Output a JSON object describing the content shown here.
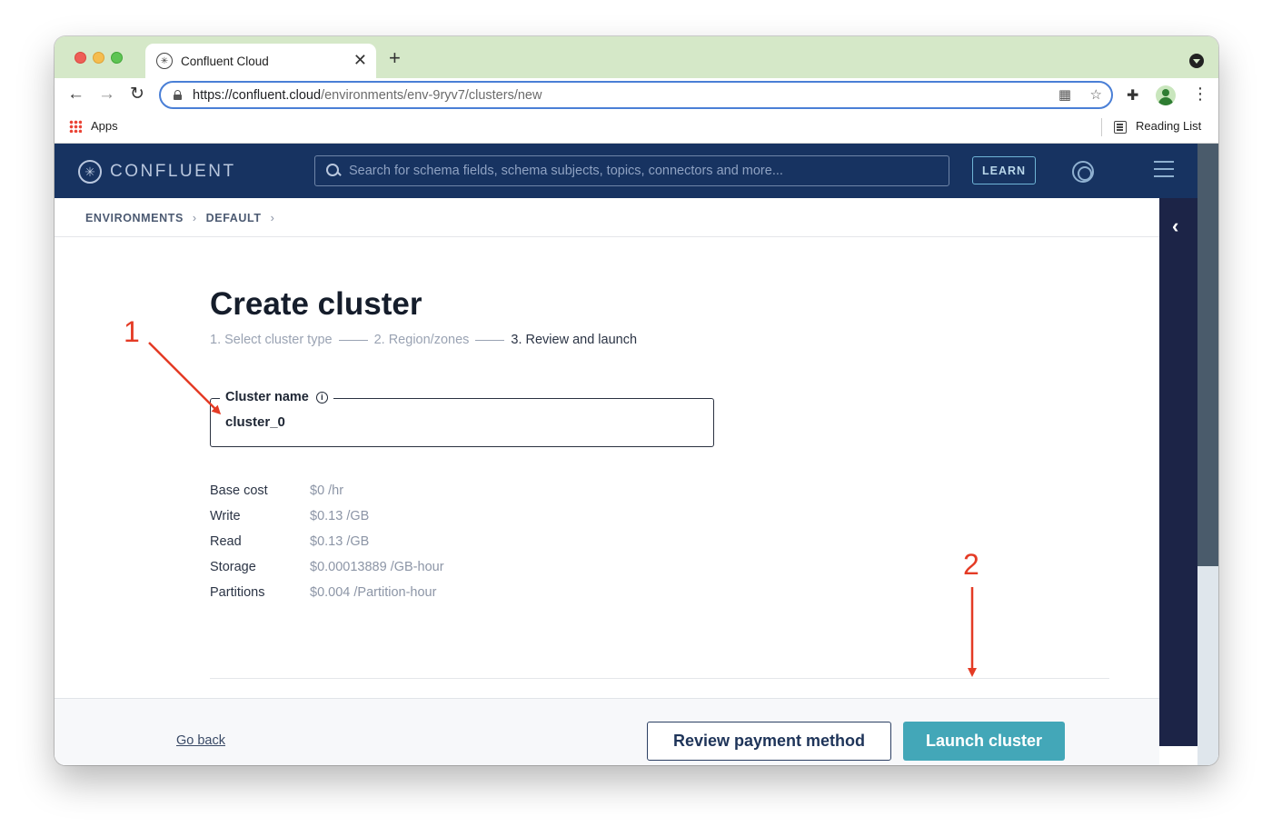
{
  "browser": {
    "tab_title": "Confluent Cloud",
    "url_host": "https://confluent.cloud",
    "url_path": "/environments/env-9ryv7/clusters/new",
    "bookmarks": {
      "apps": "Apps",
      "reading_list": "Reading List"
    },
    "icons": [
      "back-arrow-icon",
      "forward-arrow-icon",
      "reload-icon",
      "lock-icon",
      "qr-icon",
      "star-icon",
      "extensions-icon",
      "profile-icon",
      "more-icon"
    ]
  },
  "header": {
    "logo": "CONFLUENT",
    "search_placeholder": "Search for schema fields, schema subjects, topics, connectors and more...",
    "learn_label": "LEARN"
  },
  "breadcrumb": [
    "ENVIRONMENTS",
    "DEFAULT"
  ],
  "page": {
    "title": "Create cluster",
    "steps": [
      "1. Select cluster type",
      "2. Region/zones",
      "3. Review and launch"
    ],
    "active_step": 2,
    "cluster_name_label": "Cluster name",
    "cluster_name_value": "cluster_0"
  },
  "costs": [
    {
      "label": "Base cost",
      "value": "$0 /hr"
    },
    {
      "label": "Write",
      "value": "$0.13 /GB"
    },
    {
      "label": "Read",
      "value": "$0.13 /GB"
    },
    {
      "label": "Storage",
      "value": "$0.00013889 /GB-hour"
    },
    {
      "label": "Partitions",
      "value": "$0.004 /Partition-hour"
    }
  ],
  "footer": {
    "go_back": "Go back",
    "review_payment": "Review payment method",
    "launch": "Launch cluster"
  },
  "annotations": {
    "marker_1": "1",
    "marker_2": "2",
    "color": "#e43b25"
  },
  "colors": {
    "header_bg": "#173361",
    "primary_button": "#43a7b8",
    "rail_bg": "#1c2447"
  }
}
